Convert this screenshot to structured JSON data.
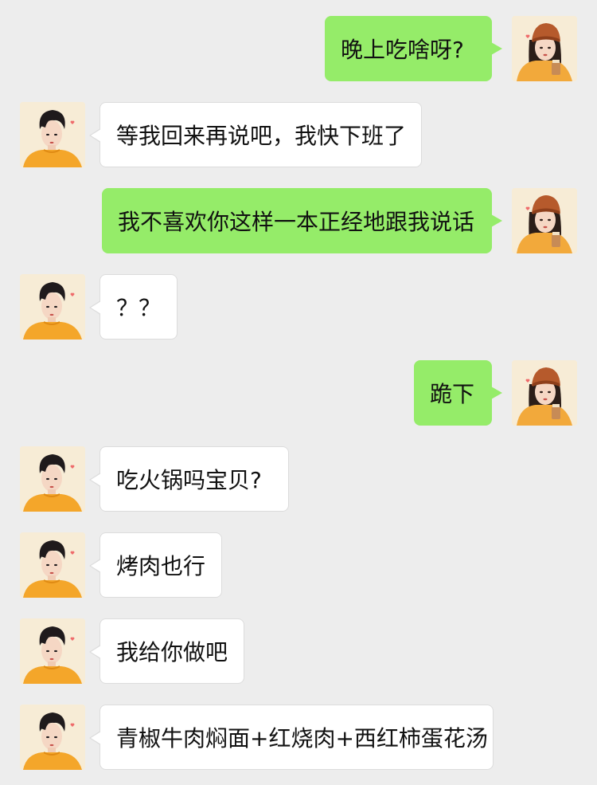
{
  "conversation": {
    "messages": [
      {
        "side": "out",
        "text": "晚上吃啥呀?"
      },
      {
        "side": "in",
        "text": "等我回来再说吧，我快下班了"
      },
      {
        "side": "out",
        "text": "我不喜欢你这样一本正经地跟我说话"
      },
      {
        "side": "in",
        "text": "？？"
      },
      {
        "side": "out",
        "text": "跪下"
      },
      {
        "side": "in",
        "text": "吃火锅吗宝贝?"
      },
      {
        "side": "in",
        "text": "烤肉也行"
      },
      {
        "side": "in",
        "text": "我给你做吧"
      },
      {
        "side": "in",
        "text": "青椒牛肉焖面+红烧肉+西红柿蛋花汤"
      }
    ]
  },
  "colors": {
    "background": "#ededed",
    "outgoing_bubble": "#95ec69",
    "incoming_bubble": "#ffffff"
  },
  "icons": {
    "outgoing_avatar": "girl-avatar-icon",
    "incoming_avatar": "boy-avatar-icon"
  }
}
